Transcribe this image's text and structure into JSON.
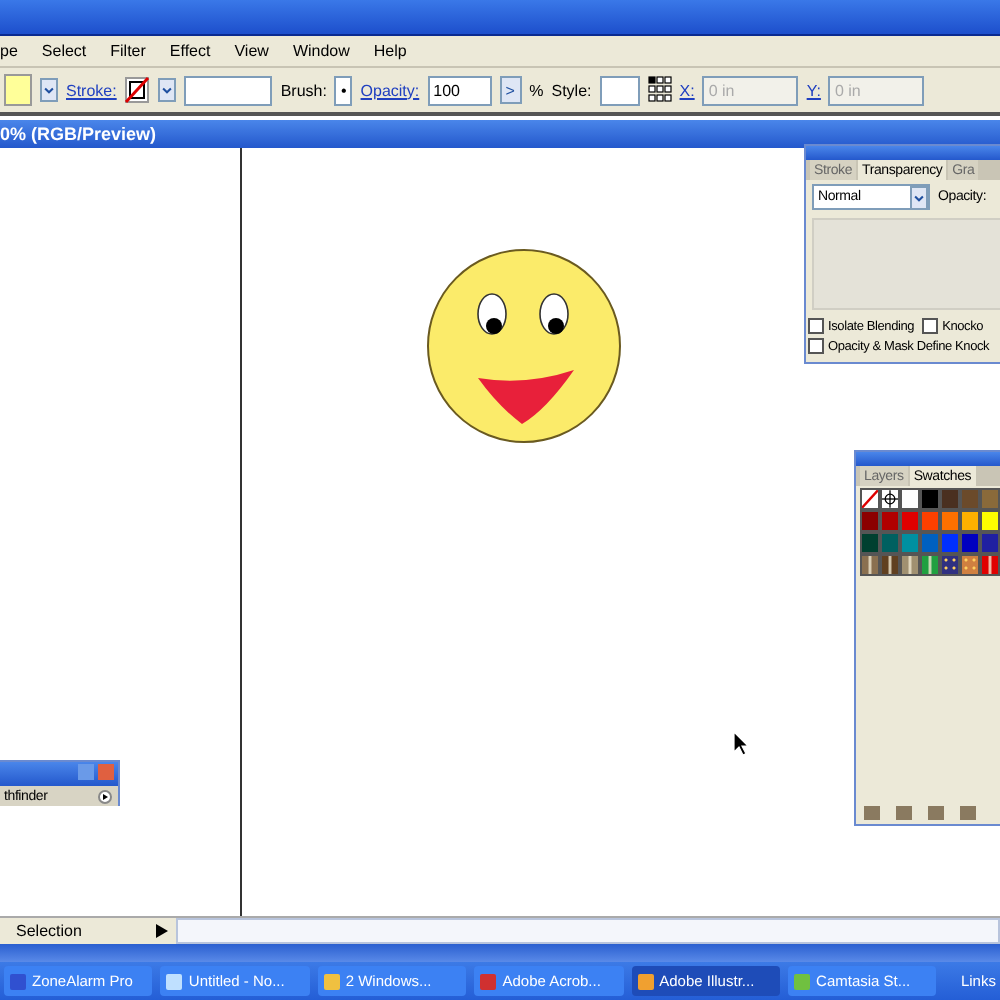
{
  "menu": [
    "pe",
    "Select",
    "Filter",
    "Effect",
    "View",
    "Window",
    "Help"
  ],
  "control_bar": {
    "stroke_label": "Stroke:",
    "brush_label": "Brush:",
    "brush_value": "•",
    "opacity_label": "Opacity:",
    "opacity_value": "100",
    "opacity_arrow": ">",
    "percent": "%",
    "style_label": "Style:",
    "x_label": "X:",
    "x_value": "0 in",
    "y_label": "Y:",
    "y_value": "0 in"
  },
  "document": {
    "title": "0% (RGB/Preview)"
  },
  "transparency_panel": {
    "tabs": [
      {
        "label": "Stroke",
        "selected": false
      },
      {
        "label": "Transparency",
        "selected": true
      },
      {
        "label": "Gra",
        "selected": false
      }
    ],
    "blend_mode": "Normal",
    "opacity_label": "Opacity:",
    "options": [
      {
        "label": "Isolate Blending",
        "checked": false
      },
      {
        "label": "Knocko",
        "checked": false
      }
    ],
    "mask_option": {
      "label": "Opacity & Mask Define Knock",
      "checked": false
    }
  },
  "swatches_panel": {
    "tabs": [
      {
        "label": "Layers",
        "selected": false
      },
      {
        "label": "Swatches",
        "selected": true
      }
    ],
    "swatches": [
      {
        "kind": "none"
      },
      {
        "kind": "registration"
      },
      {
        "kind": "solid",
        "color": "#ffffff"
      },
      {
        "kind": "solid",
        "color": "#000000"
      },
      {
        "kind": "solid",
        "color": "#4a3020"
      },
      {
        "kind": "solid",
        "color": "#6b4a2a"
      },
      {
        "kind": "solid",
        "color": "#8a6a3a"
      },
      {
        "kind": "solid",
        "color": "#8b0000"
      },
      {
        "kind": "solid",
        "color": "#b00000"
      },
      {
        "kind": "solid",
        "color": "#e00000"
      },
      {
        "kind": "solid",
        "color": "#ff4000"
      },
      {
        "kind": "solid",
        "color": "#ff7000"
      },
      {
        "kind": "solid",
        "color": "#ffb000"
      },
      {
        "kind": "solid",
        "color": "#ffff00"
      },
      {
        "kind": "solid",
        "color": "#004030"
      },
      {
        "kind": "solid",
        "color": "#006060"
      },
      {
        "kind": "solid",
        "color": "#0090a0"
      },
      {
        "kind": "solid",
        "color": "#0060c0"
      },
      {
        "kind": "solid",
        "color": "#0030ff"
      },
      {
        "kind": "solid",
        "color": "#0000c0"
      },
      {
        "kind": "solid",
        "color": "#2020a0"
      },
      {
        "kind": "gradient",
        "color": "#8a7050"
      },
      {
        "kind": "gradient",
        "color": "#604020"
      },
      {
        "kind": "gradient",
        "color": "#a09070"
      },
      {
        "kind": "gradient",
        "color": "#20a040"
      },
      {
        "kind": "pattern",
        "color": "#303080"
      },
      {
        "kind": "pattern",
        "color": "#d08040"
      },
      {
        "kind": "gradient",
        "color": "#e00000"
      }
    ]
  },
  "pathfinder_panel": {
    "tab": "thfinder"
  },
  "status_bar": {
    "tool": "Selection"
  },
  "taskbar": [
    {
      "label": "ZoneAlarm Pro",
      "selected": false
    },
    {
      "label": "Untitled - No...",
      "selected": false
    },
    {
      "label": "2 Windows...",
      "selected": false
    },
    {
      "label": "Adobe Acrob...",
      "selected": false
    },
    {
      "label": "Adobe Illustr...",
      "selected": true
    },
    {
      "label": "Camtasia St...",
      "selected": false
    }
  ],
  "links": "Links"
}
